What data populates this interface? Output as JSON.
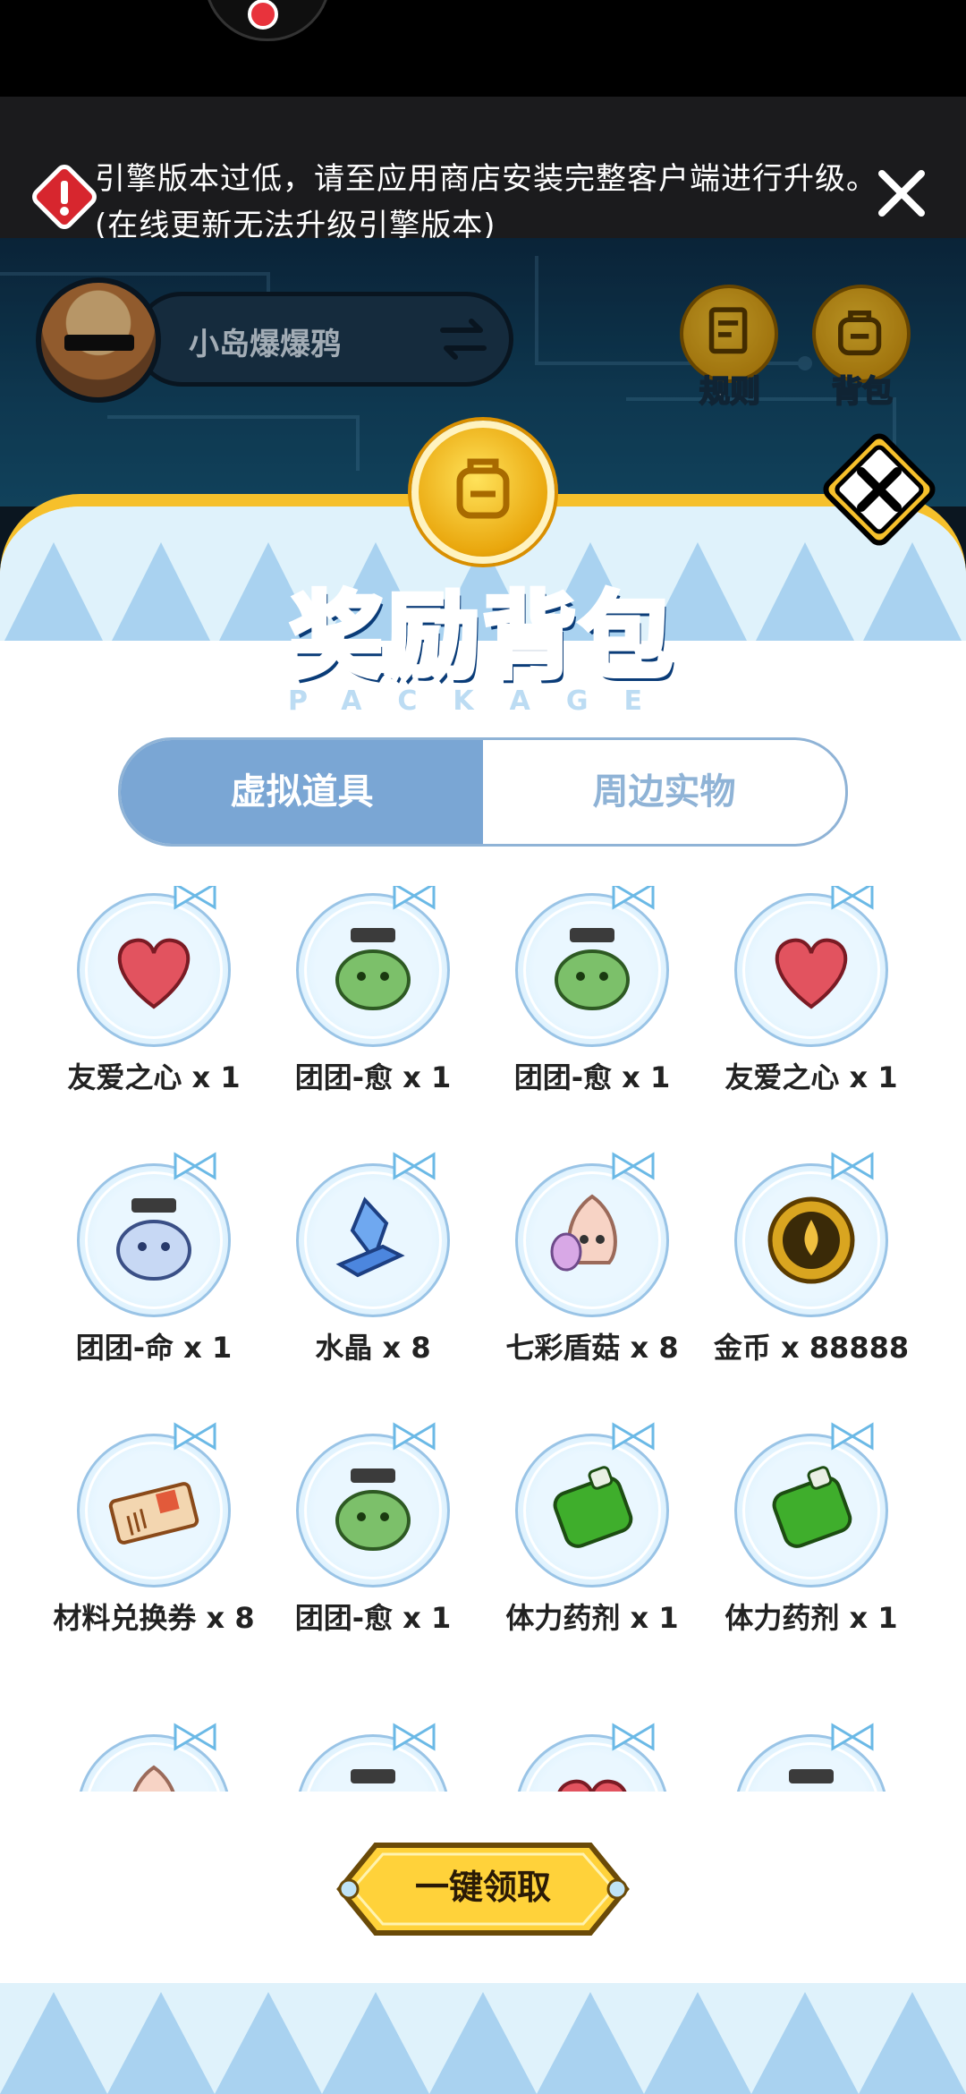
{
  "banner": {
    "text": "引擎版本过低，请至应用商店安装完整客户端进行升级。(在线更新无法升级引擎版本)"
  },
  "header": {
    "username": "小岛爆爆鸦",
    "rules_label": "规则",
    "bag_label": "背包"
  },
  "panel": {
    "title": "奖励背包",
    "subtitle": "PACKAGE",
    "tabs": [
      {
        "label": "虚拟道具",
        "active": true
      },
      {
        "label": "周边实物",
        "active": false
      }
    ],
    "items": [
      {
        "label": "友爱之心 x 1",
        "icon": "heart-icon"
      },
      {
        "label": "团团-愈 x 1",
        "icon": "green-cat-icon"
      },
      {
        "label": "团团-愈 x 1",
        "icon": "green-cat-icon"
      },
      {
        "label": "友爱之心 x 1",
        "icon": "heart-icon"
      },
      {
        "label": "团团-命 x 1",
        "icon": "blue-cat-icon"
      },
      {
        "label": "水晶 x 8",
        "icon": "crystal-icon"
      },
      {
        "label": "七彩盾菇 x 8",
        "icon": "mushroom-icon"
      },
      {
        "label": "金币 x 88888",
        "icon": "gold-coin-icon"
      },
      {
        "label": "材料兑换券 x 8",
        "icon": "ticket-icon"
      },
      {
        "label": "团团-愈 x 1",
        "icon": "green-cat-icon"
      },
      {
        "label": "体力药剂 x 1",
        "icon": "potion-icon"
      },
      {
        "label": "体力药剂 x 1",
        "icon": "potion-icon"
      },
      {
        "label": "",
        "icon": "mushroom-icon"
      },
      {
        "label": "",
        "icon": "green-cat-icon"
      },
      {
        "label": "",
        "icon": "heart-icon"
      },
      {
        "label": "",
        "icon": "blue-cat-icon"
      }
    ],
    "claim_label": "一键领取"
  },
  "colors": {
    "panel_border": "#f6c02b",
    "tab_active": "#7aa6d4",
    "title_blue": "#2aa8e8"
  }
}
